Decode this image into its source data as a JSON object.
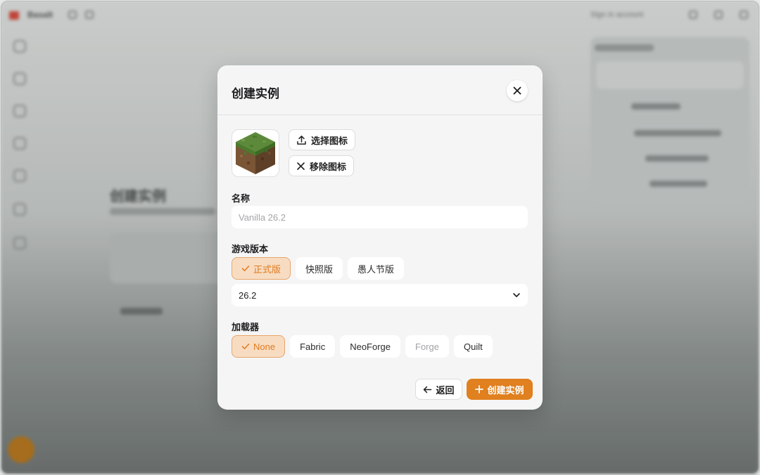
{
  "background": {
    "app_name": "Basalt",
    "account_label": "Sign in account",
    "main_title": "创建实例"
  },
  "dialog": {
    "title": "创建实例",
    "select_icon_label": "选择图标",
    "remove_icon_label": "移除图标",
    "name_label": "名称",
    "name_placeholder": "Vanilla 26.2",
    "version_label": "游戏版本",
    "version_types": [
      {
        "label": "正式版",
        "selected": true
      },
      {
        "label": "快照版",
        "selected": false
      },
      {
        "label": "愚人节版",
        "selected": false
      }
    ],
    "selected_version": "26.2",
    "loader_label": "加载器",
    "loaders": [
      {
        "label": "None",
        "selected": true
      },
      {
        "label": "Fabric",
        "selected": false
      },
      {
        "label": "NeoForge",
        "selected": false
      },
      {
        "label": "Forge",
        "selected": false,
        "disabled": true
      },
      {
        "label": "Quilt",
        "selected": false
      }
    ],
    "back_label": "返回",
    "create_label": "创建实例"
  },
  "colors": {
    "accent": "#e0801f",
    "accent_soft": "#f7dcc2",
    "dialog_bg": "#f5f5f6"
  },
  "icons": {
    "close": "close-icon",
    "upload": "upload-icon",
    "remove": "x-icon",
    "check": "check-icon",
    "chevron": "chevron-down-icon",
    "back": "arrow-left-icon",
    "plus": "plus-icon",
    "instance": "grass-block-icon"
  }
}
